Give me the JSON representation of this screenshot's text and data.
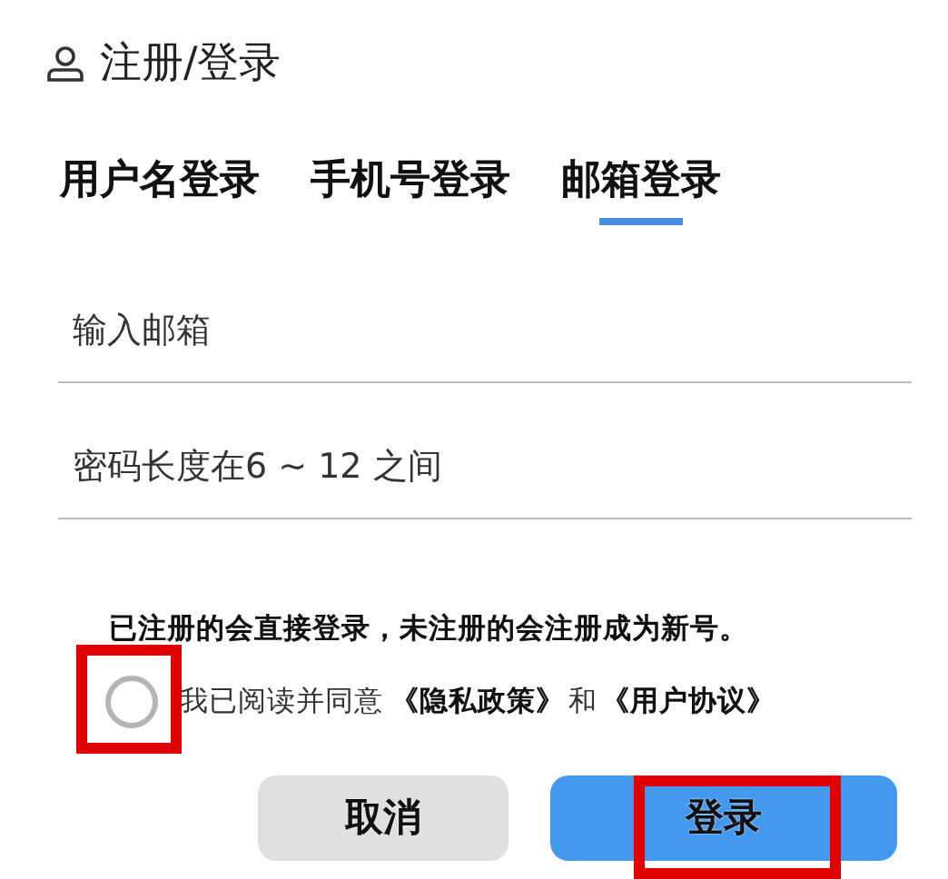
{
  "header": {
    "title": "注册/登录"
  },
  "tabs": [
    {
      "label": "用户名登录",
      "selected": false
    },
    {
      "label": "手机号登录",
      "selected": false
    },
    {
      "label": "邮箱登录",
      "selected": true
    }
  ],
  "fields": [
    {
      "placeholder": "输入邮箱"
    },
    {
      "placeholder": "密码长度在6 ~ 12 之间"
    }
  ],
  "notice": "已注册的会直接登录，未注册的会注册成为新号。",
  "agreement": {
    "checked": false,
    "text": "我已阅读并同意",
    "privacy_link": "《隐私政策》",
    "and": "和",
    "terms_link": "《用户协议》"
  },
  "buttons": [
    {
      "label": "取消",
      "kind": "secondary"
    },
    {
      "label": "登录",
      "kind": "primary"
    }
  ]
}
